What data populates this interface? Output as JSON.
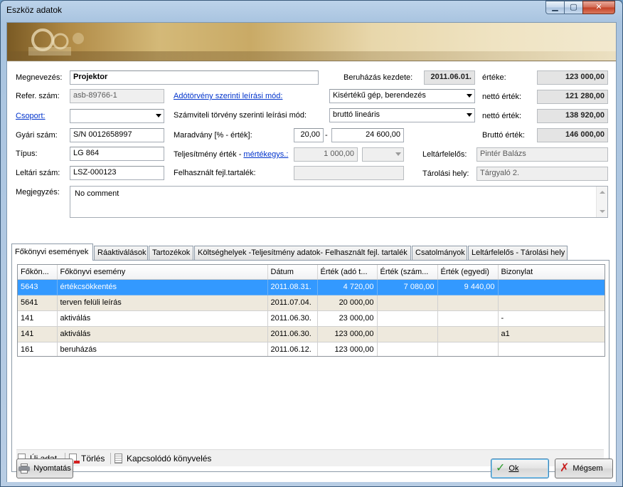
{
  "window": {
    "title": "Eszköz adatok",
    "minimize": "▁",
    "maximize": "▢",
    "close": "✕"
  },
  "form": {
    "megnevezes_label": "Megnevezés:",
    "megnevezes_value": "Projektor",
    "refer_label": "Refer. szám:",
    "refer_value": "asb-89766-1",
    "csoport_label": "Csoport:",
    "csoport_value": "",
    "gyari_label": "Gyári szám:",
    "gyari_value": "S/N 0012658997",
    "tipus_label": "Típus:",
    "tipus_value": "LG 864",
    "leltari_label": "Leltári szám:",
    "leltari_value": "LSZ-000123",
    "megjegyzes_label": "Megjegyzés:",
    "megjegyzes_value": "No comment",
    "beruhazas_label": "Beruházás kezdete:",
    "beruhazas_value": "2011.06.01.",
    "adotorveny_label": "Adótörvény szerinti leírási mód:",
    "adotorveny_value": "Kisértékű gép, berendezés",
    "szamviteli_label": "Számviteli törvény szerinti leírási mód:",
    "szamviteli_value": "bruttó lineáris",
    "maradvany_label": "Maradvány [% - érték]:",
    "maradvany_pct": "20,00",
    "maradvany_dash": "-",
    "maradvany_value": "24 600,00",
    "teljesitmeny_label": "Teljesítmény érték - ",
    "mertekegys_link": "mértékegys.:",
    "teljesitmeny_value": "1 000,00",
    "teljesitmeny_unit": "",
    "felhasznalt_label": "Felhasznált fejl.tartalék:",
    "felhasznalt_value": "",
    "erteke_label": "értéke:",
    "erteke_value": "123 000,00",
    "netto1_label": "nettó érték:",
    "netto1_value": "121 280,00",
    "netto2_label": "nettó érték:",
    "netto2_value": "138 920,00",
    "brutto_label": "Bruttó érték:",
    "brutto_value": "146 000,00",
    "leltarfelelos_label": "Leltárfelelős:",
    "leltarfelelos_value": "Pintér Balázs",
    "tarolasi_label": "Tárolási hely:",
    "tarolasi_value": "Tárgyaló 2."
  },
  "tabs": [
    {
      "label": "Főkönyvi események"
    },
    {
      "label": "Ráaktiválások"
    },
    {
      "label": "Tartozékok"
    },
    {
      "label": "Költséghelyek -Teljesítmény adatok- Felhasznált fejl. tartalék"
    },
    {
      "label": "Csatolmányok"
    },
    {
      "label": "Leltárfelelős - Tárolási hely"
    }
  ],
  "grid": {
    "columns": [
      "Főkön...",
      "Főkönyvi esemény",
      "Dátum",
      "Érték (adó t...",
      "Érték (szám...",
      "Érték (egyedi)",
      "Bizonylat"
    ],
    "rows": [
      {
        "fokonyv": "5643",
        "esemeny": "értékcsökkentés",
        "datum": "2011.08.31.",
        "ado": "4 720,00",
        "szam": "7 080,00",
        "egyedi": "9 440,00",
        "bizonylat": ""
      },
      {
        "fokonyv": "5641",
        "esemeny": "terven felüli leírás",
        "datum": "2011.07.04.",
        "ado": "20 000,00",
        "szam": "",
        "egyedi": "",
        "bizonylat": ""
      },
      {
        "fokonyv": "141",
        "esemeny": "aktiválás",
        "datum": "2011.06.30.",
        "ado": "23 000,00",
        "szam": "",
        "egyedi": "",
        "bizonylat": "-"
      },
      {
        "fokonyv": "141",
        "esemeny": "aktiválás",
        "datum": "2011.06.30.",
        "ado": "123 000,00",
        "szam": "",
        "egyedi": "",
        "bizonylat": "a1"
      },
      {
        "fokonyv": "161",
        "esemeny": "beruházás",
        "datum": "2011.06.12.",
        "ado": "123 000,00",
        "szam": "",
        "egyedi": "",
        "bizonylat": ""
      }
    ]
  },
  "toolbar": {
    "new_label": "Új adat",
    "delete_label": "Törlés",
    "related_label": "Kapcsolódó könyvelés"
  },
  "buttons": {
    "print_label": "Nyomtatás",
    "ok_label": "Ok",
    "cancel_label": "Mégsem"
  }
}
